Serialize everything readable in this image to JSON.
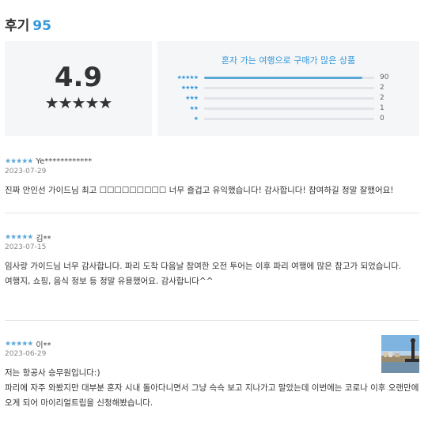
{
  "header": {
    "title": "후기",
    "count": "95"
  },
  "summary": {
    "average": "4.9",
    "stars": "★★★★★"
  },
  "distribution": {
    "title": "혼자 가는 여행으로 구매가 많은 상품",
    "rows": [
      {
        "label": "★★★★★",
        "count": "90",
        "fraction": 0.93
      },
      {
        "label": "★★★★",
        "count": "2",
        "fraction": 0
      },
      {
        "label": "★★★",
        "count": "2",
        "fraction": 0
      },
      {
        "label": "★★",
        "count": "1",
        "fraction": 0
      },
      {
        "label": "★",
        "count": "0",
        "fraction": 0
      }
    ]
  },
  "reviews": [
    {
      "stars": "★★★★★",
      "user": "Ye************",
      "date": "2023-07-29",
      "text": "진짜 안인선 가이드님 최고 ☐☐☐☐☐☐☐☐☐ 너무 즐겁고 유익했습니다! 감사합니다! 참여하길 정말 잘했어요!"
    },
    {
      "stars": "★★★★★",
      "user": "김**",
      "date": "2023-07-15",
      "text": "임사랑 가이드님 너무 감사합니다. 파리 도착 다음날 참여한 오전 투어는 이후 파리 여행에 많은 참고가 되었습니다.\n여행지, 쇼핑, 음식 정보 등 정말 유용했어요. 감사합니다^^"
    },
    {
      "stars": "★★★★★",
      "user": "이**",
      "date": "2023-06-29",
      "text": "저는 항공사 승무원입니다:)\n파리에 자주 와봤지만 대부분 혼자 시내 돌아다니면서 그냥 슥슥 보고 지나가고 말았는데 이번에는 코로나 이후 오랜만에 오게 되어 마이리얼트립을 신청해봤습니다."
    }
  ]
}
